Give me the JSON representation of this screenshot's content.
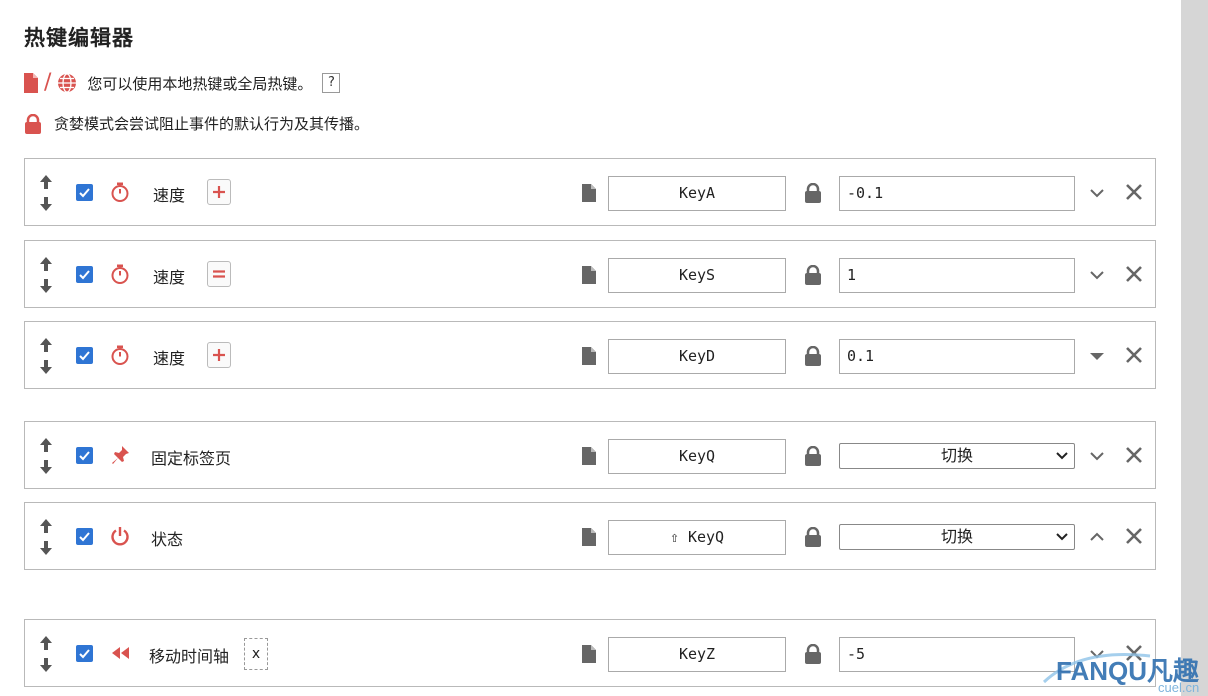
{
  "title": "热键编辑器",
  "info": {
    "scope_text": "您可以使用本地热键或全局热键。",
    "help_label": "?",
    "greedy_text": "贪婪模式会尝试阻止事件的默认行为及其传播。"
  },
  "rows": [
    {
      "name": "速度",
      "op": "+",
      "key": "KeyA",
      "value": "-0.1",
      "expand": "down"
    },
    {
      "name": "速度",
      "op": "=",
      "key": "KeyS",
      "value": "1",
      "expand": "down"
    },
    {
      "name": "速度",
      "op": "+",
      "key": "KeyD",
      "value": "0.1",
      "expand": "down-filled"
    },
    {
      "name": "固定标签页",
      "key": "KeyQ",
      "select": "切换",
      "expand": "down"
    },
    {
      "name": "状态",
      "key": "⇧ KeyQ",
      "select": "切换",
      "expand": "up"
    },
    {
      "name": "移动时间轴",
      "extra": "x",
      "key": "KeyZ",
      "value": "-5",
      "expand": "down"
    }
  ],
  "watermark": {
    "brand": "FANQU凡趣",
    "domain": "cuel.cn"
  },
  "colors": {
    "accent_red": "#d9534f",
    "checkbox_blue": "#2f75d4"
  }
}
